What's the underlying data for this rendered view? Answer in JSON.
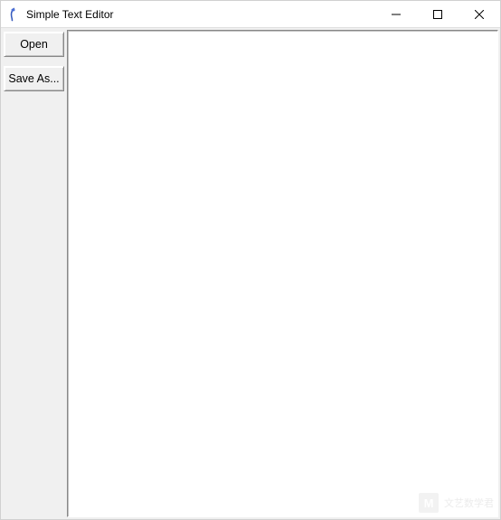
{
  "window": {
    "title": "Simple Text Editor"
  },
  "sidebar": {
    "open_label": "Open",
    "save_as_label": "Save As..."
  },
  "editor": {
    "content": ""
  },
  "watermark": {
    "logo_text": "M",
    "label": "文艺数学君"
  }
}
